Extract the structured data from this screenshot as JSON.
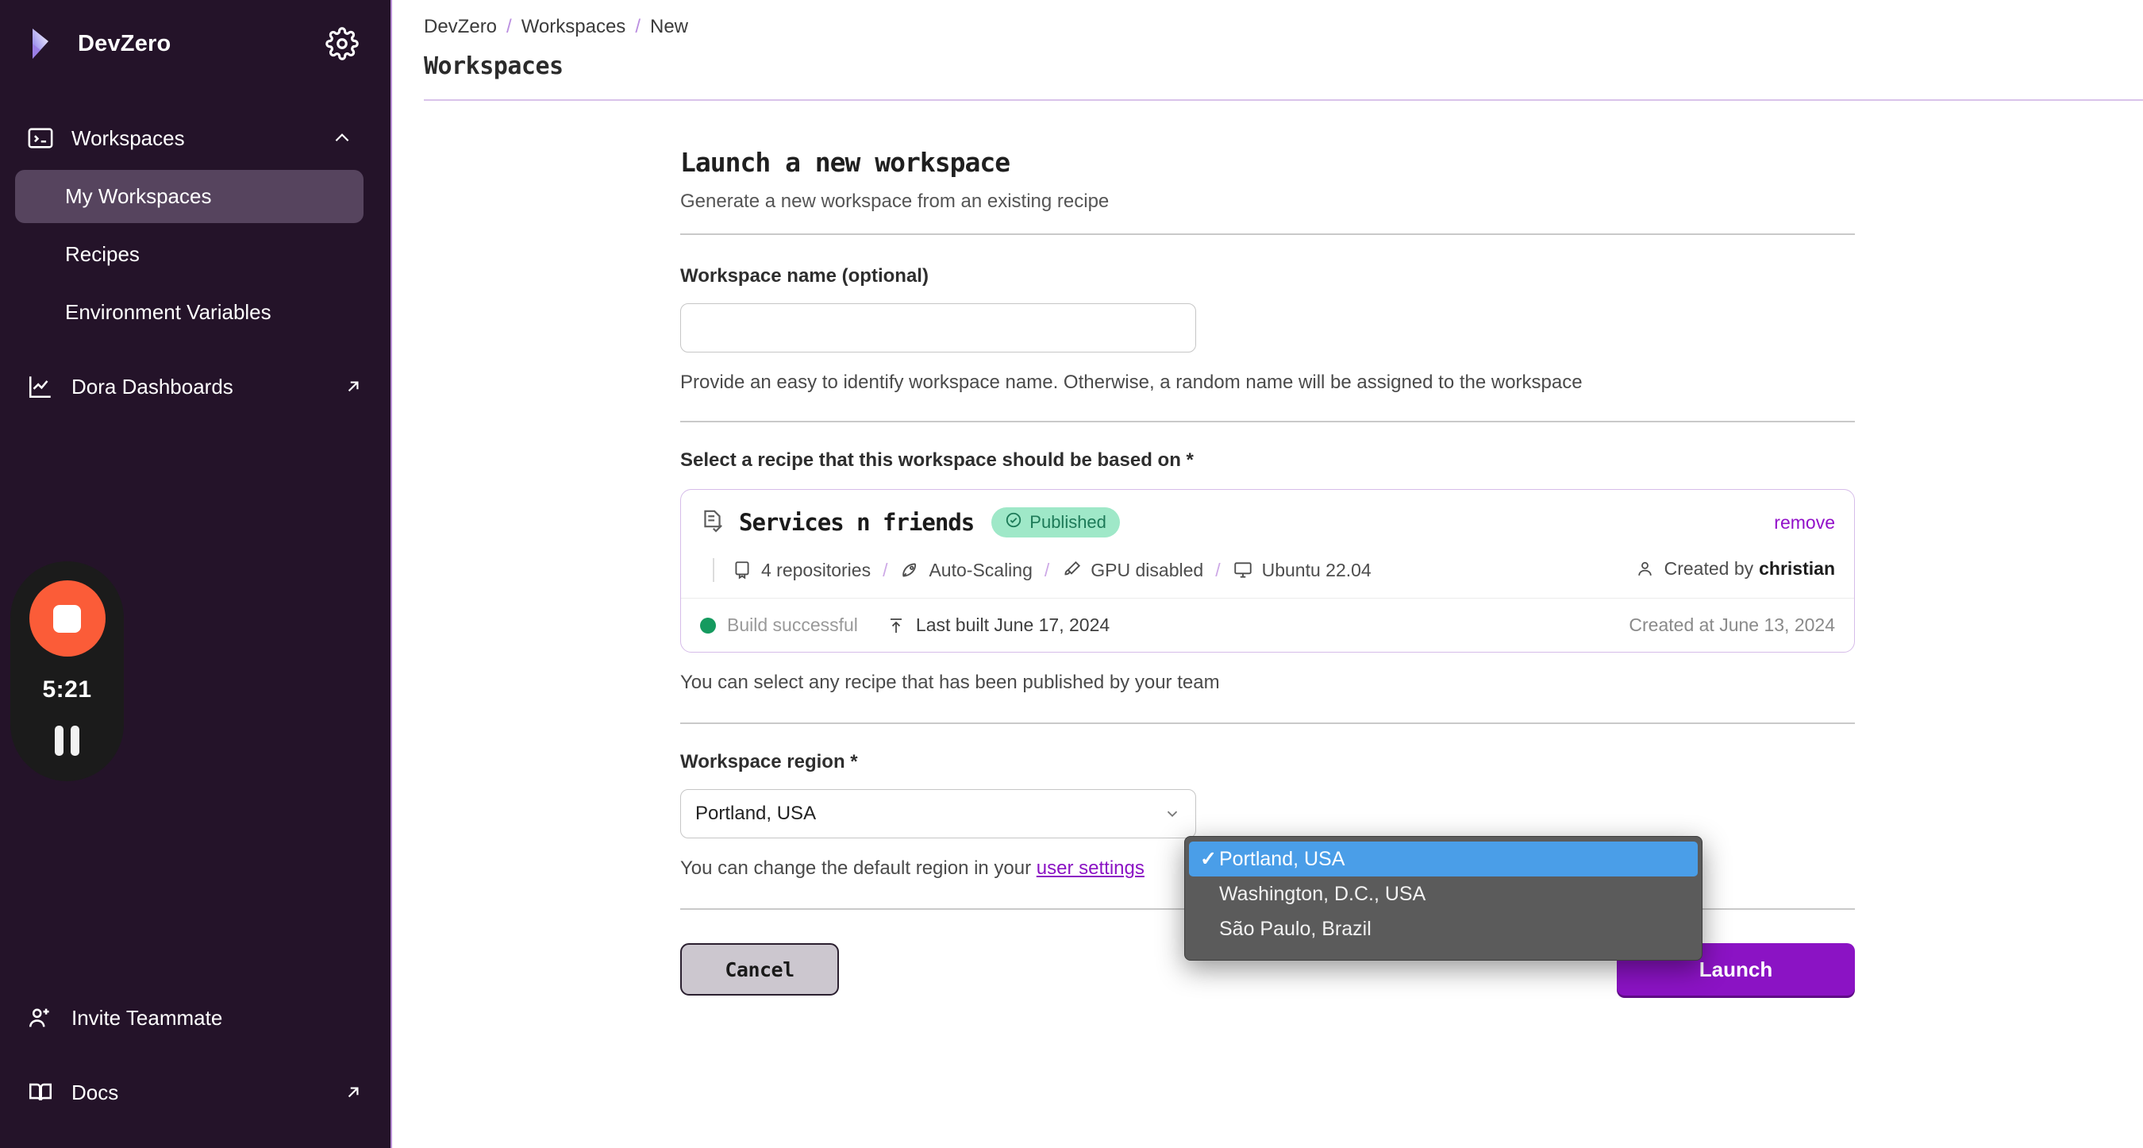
{
  "sidebar": {
    "brand": "DevZero",
    "gear_icon": "gear-icon",
    "group": {
      "label": "Workspaces",
      "icon": "terminal-icon",
      "chevron": "chevron-up-icon"
    },
    "items": [
      {
        "label": "My Workspaces",
        "active": true
      },
      {
        "label": "Recipes",
        "active": false
      },
      {
        "label": "Environment Variables",
        "active": false
      }
    ],
    "dashboards": {
      "label": "Dora Dashboards",
      "icon": "chart-line-icon",
      "external_icon": "arrow-up-right-icon"
    },
    "bottom": [
      {
        "label": "Invite Teammate",
        "icon": "user-plus-icon",
        "external": false
      },
      {
        "label": "Docs",
        "icon": "book-open-icon",
        "external": true
      }
    ]
  },
  "recorder": {
    "stop_icon": "stop-square-icon",
    "time": "5:21",
    "pause_icon": "pause-icon",
    "accent": "#fb5c38"
  },
  "header": {
    "breadcrumbs": [
      "DevZero",
      "Workspaces",
      "New"
    ],
    "separator": "/",
    "title": "Workspaces"
  },
  "form": {
    "title": "Launch a new workspace",
    "subtitle": "Generate a new workspace from an existing recipe",
    "name_field": {
      "label": "Workspace name (optional)",
      "value": "",
      "placeholder": "",
      "help": "Provide an easy to identify workspace name. Otherwise, a random name will be assigned to the workspace"
    },
    "recipe_field": {
      "label": "Select a recipe that this workspace should be based on *",
      "help": "You can select any recipe that has been published by your team"
    },
    "recipe": {
      "name": "Services n friends",
      "badge": "Published",
      "badge_icon": "check-circle-icon",
      "badge_bg": "#9fe8c8",
      "badge_fg": "#1d7a58",
      "remove_label": "remove",
      "meta": [
        {
          "icon": "repository-icon",
          "text": "4 repositories"
        },
        {
          "icon": "rocket-icon",
          "text": "Auto-Scaling"
        },
        {
          "icon": "brush-icon",
          "text": "GPU disabled"
        },
        {
          "icon": "monitor-icon",
          "text": "Ubuntu 22.04"
        }
      ],
      "meta_separator": "/",
      "created_by_prefix": "Created by",
      "created_by": "christian",
      "created_by_icon": "user-icon",
      "build_status": "Build successful",
      "build_status_color": "#159a5f",
      "last_built": "Last built June 17, 2024",
      "last_built_icon": "upload-icon",
      "created_at": "Created at June 13, 2024"
    },
    "region_field": {
      "label": "Workspace region *",
      "selected": "Portland, USA",
      "help_prefix": "You can change the default region in your ",
      "help_link": "user settings",
      "chevron": "chevron-down-icon"
    },
    "region_dropdown": {
      "open": true,
      "check_glyph": "✓",
      "highlight_color": "#4a9ee8",
      "options": [
        {
          "label": "Portland, USA",
          "selected": true
        },
        {
          "label": "Washington, D.C., USA",
          "selected": false
        },
        {
          "label": "São Paulo, Brazil",
          "selected": false
        }
      ]
    },
    "buttons": {
      "cancel": "Cancel",
      "launch": "Launch",
      "launch_color": "#8b13c4"
    }
  }
}
